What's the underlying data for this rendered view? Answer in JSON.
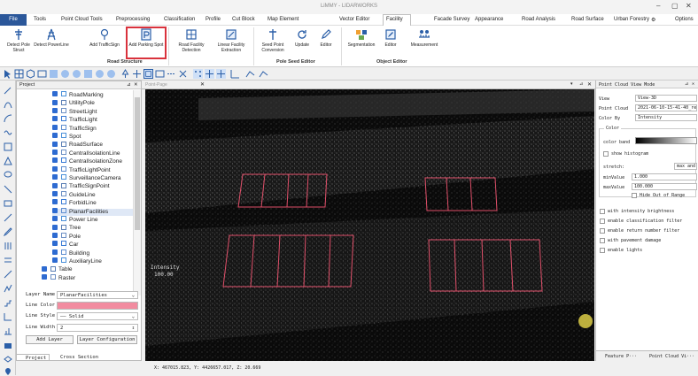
{
  "window": {
    "title": "LiMMY - LIDARWORKS",
    "min": "–",
    "max": "▢",
    "close": "✕"
  },
  "menu": {
    "items": [
      "File",
      "Tools",
      "Point Cloud Tools",
      "Preprocessing",
      "Classification",
      "Profile",
      "Cut Block",
      "Map Element",
      "Facility",
      "Vector Editor",
      "Facade Survey",
      "Appearance",
      "Road Analysis",
      "Road Surface",
      "Urban Forestry"
    ],
    "options": "Options",
    "active": "Facility"
  },
  "ribbon": {
    "buttons": {
      "detect_pole": "Detect Pole Struct",
      "detect_powerline": "Detect PowerLine",
      "add_trafficsign": "Add TrafficSign",
      "add_parking_spot": "Add Parking Spot",
      "road_facility_detection": "Road Facility Detection",
      "linear_facility_extraction": "Linear Facility Extraction",
      "seed_point_conversion": "Seed Point Conversion",
      "update": "Update",
      "editor1": "Editor",
      "segmentation": "Segmentation",
      "editor2": "Editor",
      "measurement": "Measurement"
    },
    "groups": {
      "road_structure": "Road Structure",
      "pole_seed_editor": "Pole Seed Editor",
      "object_editor": "Object Editor"
    }
  },
  "project": {
    "title": "Project",
    "layers": [
      "RoadMarking",
      "UtilityPole",
      "StreetLight",
      "TrafficLight",
      "TrafficSign",
      "Spot",
      "RoadSurface",
      "CentralIsolationLine",
      "CentralIsolationZone",
      "TrafficLightPoint",
      "SurveillanceCamera",
      "TrafficSignPoint",
      "GuideLine",
      "ForbidLine",
      "PlanarFacilities",
      "Power Line",
      "Tree",
      "Pole",
      "Car",
      "Building",
      "AuxiliaryLine",
      "Table",
      "Raster"
    ],
    "selected": "PlanarFacilities"
  },
  "properties": {
    "layer_name_label": "Layer Name",
    "layer_name": "PlanarFacilities",
    "line_color_label": "Line Color",
    "line_color": "#f28ca0",
    "line_style_label": "Line Style",
    "line_style": "—— Solid",
    "line_width_label": "Line Width",
    "line_width": "2",
    "add_layer": "Add Layer",
    "layer_config": "Layer Configuration"
  },
  "bottom_tabs": {
    "project": "Project",
    "cross_section": "Cross Section"
  },
  "viewport": {
    "tab": "Point-Page",
    "intensity_label": "Intensity",
    "intensity_value": "100.00",
    "polygon_color": "#e0506a"
  },
  "right_panel": {
    "title": "Point Cloud View Mode",
    "view_label": "View",
    "view_value": "View-3D",
    "point_cloud_label": "Point Cloud",
    "point_cloud_value": "2021-06-10-15-41-40_result(1)",
    "color_by_label": "Color By",
    "color_by_value": "Intensity",
    "color_group": "Color",
    "color_band_label": "color band",
    "show_histogram": "show histogram",
    "stretch_label": "stretch:",
    "stretch_value": "max and m",
    "min_value_label": "minValue",
    "min_value": "1.000",
    "max_value_label": "maxValue",
    "max_value": "100.000",
    "hide_out_of_range": "Hide Out of Range",
    "with_intensity_brightness": "with intensity brightness",
    "enable_classification_filter": "enable classification filter",
    "enable_return_number_filter": "enable return number filter",
    "with_pavement_damage": "with pavement damage",
    "enable_lights": "enable lights",
    "tab_feature": "Feature P···",
    "tab_pointcloud": "Point Cloud Vi···"
  },
  "status": {
    "coords": "X: 467015.823, Y: 4426657.017, Z: 20.669"
  }
}
